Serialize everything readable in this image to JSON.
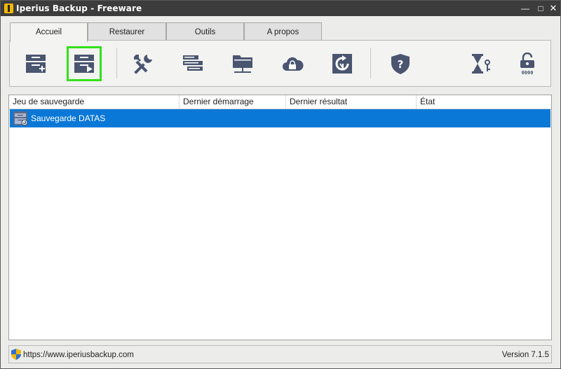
{
  "window": {
    "title": "Iperius Backup - Freeware",
    "minimize": "—",
    "maximize": "□",
    "close": "✕"
  },
  "tabs": [
    {
      "label": "Accueil",
      "active": true
    },
    {
      "label": "Restaurer",
      "active": false
    },
    {
      "label": "Outils",
      "active": false
    },
    {
      "label": "A propos",
      "active": false
    }
  ],
  "toolbar": {
    "icons": [
      "new-backup-icon",
      "run-backup-icon",
      "tools-icon",
      "list-icon",
      "network-folder-icon",
      "cloud-lock-icon",
      "restore-icon",
      "help-shield-icon",
      "hourglass-key-icon",
      "unlock-code-icon"
    ],
    "unlock_code": "0000",
    "selected": "run-backup-icon"
  },
  "table": {
    "columns": [
      "Jeu de sauvegarde",
      "Dernier démarrage",
      "Dernier résultat",
      "État"
    ],
    "rows": [
      {
        "name": "Sauvegarde DATAS",
        "last_start": "",
        "last_result": "",
        "state": "",
        "selected": true
      }
    ]
  },
  "status": {
    "url": "https://www.iperiusbackup.com",
    "version": "Version 7.1.5"
  },
  "colors": {
    "icon": "#4a5570",
    "selection": "#0a78d7",
    "highlight": "#33e01a",
    "titlebar": "#3c3c3c"
  }
}
